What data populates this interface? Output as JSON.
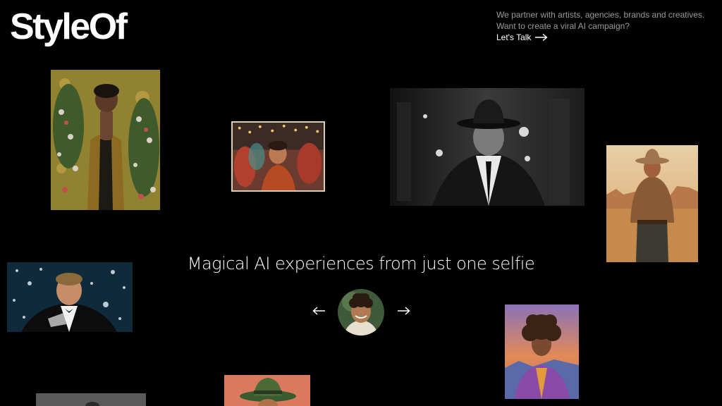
{
  "brand": {
    "logo_text": "StyleOf"
  },
  "header": {
    "pitch_line1": "We partner with artists, agencies, brands and creatives.",
    "pitch_line2": "Want to create a viral AI campaign?",
    "cta_label": "Let's Talk",
    "cta_icon": "arrow-right-icon"
  },
  "hero": {
    "headline": "Magical AI experiences from just one selfie",
    "prev_icon": "arrow-left-icon",
    "next_icon": "arrow-right-icon"
  },
  "gallery": [
    {
      "name": "floral-art-portrait",
      "style": "painterly floral"
    },
    {
      "name": "party-lights-portrait",
      "style": "festive"
    },
    {
      "name": "noir-fedora-portrait",
      "style": "black and white noir"
    },
    {
      "name": "cowboy-desert-portrait",
      "style": "western"
    },
    {
      "name": "great-gatsby-portrait",
      "style": "gatsby"
    },
    {
      "name": "psychedelic-art-portrait",
      "style": "illustration"
    },
    {
      "name": "red-cowboy-portrait",
      "style": "western"
    },
    {
      "name": "partial-bottom-portrait",
      "style": "monochrome"
    }
  ],
  "colors": {
    "background": "#000000",
    "text": "#ffffff",
    "muted_text": "#9a9a9a"
  }
}
